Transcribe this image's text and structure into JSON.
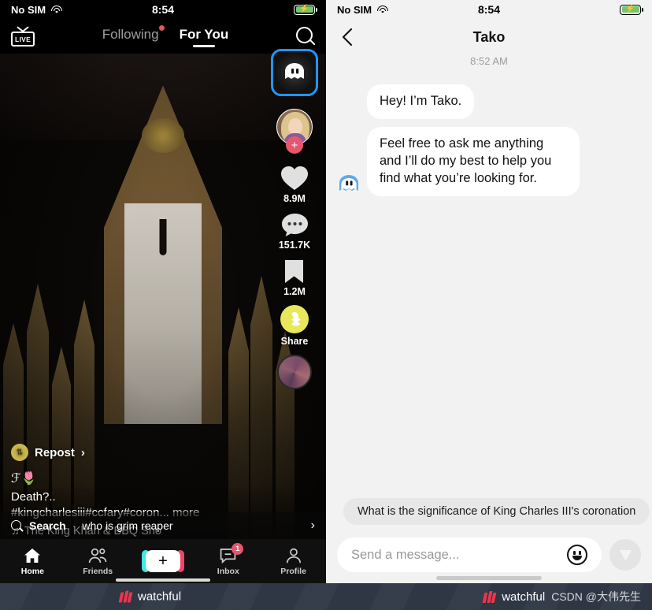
{
  "left_phone": {
    "statusbar": {
      "carrier": "No SIM",
      "time": "8:54",
      "wifi_icon": "wifi-icon",
      "battery_icon": "battery-charging-icon"
    },
    "header": {
      "live_label": "LIVE",
      "tabs": [
        {
          "label": "Following",
          "active": false,
          "has_dot": true
        },
        {
          "label": "For You",
          "active": true,
          "has_dot": false
        }
      ],
      "search_icon": "search-icon"
    },
    "action_rail": {
      "tako_button": {
        "icon": "tako-ghost-icon",
        "selected": true,
        "highlight_color": "#2395f5"
      },
      "profile": {
        "avatar": "user-avatar",
        "follow_badge": "+"
      },
      "like": {
        "icon": "heart-icon",
        "count": "8.9M"
      },
      "comment": {
        "icon": "comment-icon",
        "count": "151.7K"
      },
      "bookmark": {
        "icon": "bookmark-icon",
        "count": "1.2M"
      },
      "share": {
        "icon": "snapchat-icon",
        "label": "Share"
      },
      "music_disc": {
        "icon": "spinning-record-icon"
      }
    },
    "caption": {
      "repost_label": "Repost",
      "repost_chevron": "›",
      "handle": "ℱ🌷",
      "text": "Death?..",
      "hashtags": "#kingcharlesiii#ccfary#coron...",
      "more_label": "more",
      "music_icon": "music-note-icon",
      "music_title": "The King Khan & BBQ Sho"
    },
    "searchbar": {
      "icon": "search-icon",
      "label": "Search",
      "separator": "·",
      "query": "who is grim reaper",
      "chevron": "›"
    },
    "bottomnav": [
      {
        "label": "Home",
        "icon": "home-icon",
        "active": true,
        "badge": ""
      },
      {
        "label": "Friends",
        "icon": "friends-icon",
        "active": false,
        "badge": ""
      },
      {
        "label": "",
        "icon": "create-plus-icon",
        "active": false,
        "badge": ""
      },
      {
        "label": "Inbox",
        "icon": "inbox-icon",
        "active": false,
        "badge": "1"
      },
      {
        "label": "Profile",
        "icon": "profile-icon",
        "active": false,
        "badge": ""
      }
    ]
  },
  "right_phone": {
    "statusbar": {
      "carrier": "No SIM",
      "time": "8:54",
      "wifi_icon": "wifi-icon",
      "battery_icon": "battery-charging-icon"
    },
    "header": {
      "back_icon": "chevron-left-icon",
      "title": "Tako"
    },
    "conversation": {
      "timestamp": "8:52 AM",
      "messages": [
        {
          "sender": "tako",
          "text": "Hey! I’m Tako.",
          "show_avatar": false
        },
        {
          "sender": "tako",
          "text": "Feel free to ask me anything and I’ll do my best to help you find what you’re looking for.",
          "show_avatar": true
        }
      ],
      "avatar_icon": "tako-ghost-icon"
    },
    "suggestion_chip": "What is the significance of King Charles III's coronation",
    "composer": {
      "placeholder": "Send a message...",
      "value": "",
      "emoji_icon": "emoji-smiley-icon",
      "send_icon": "send-icon",
      "send_enabled": false
    }
  },
  "footer": {
    "left_brand": "watchful",
    "right_brand": "watchful",
    "watermark": "CSDN @大伟先生",
    "logo_icon": "watchful-logo-icon"
  }
}
